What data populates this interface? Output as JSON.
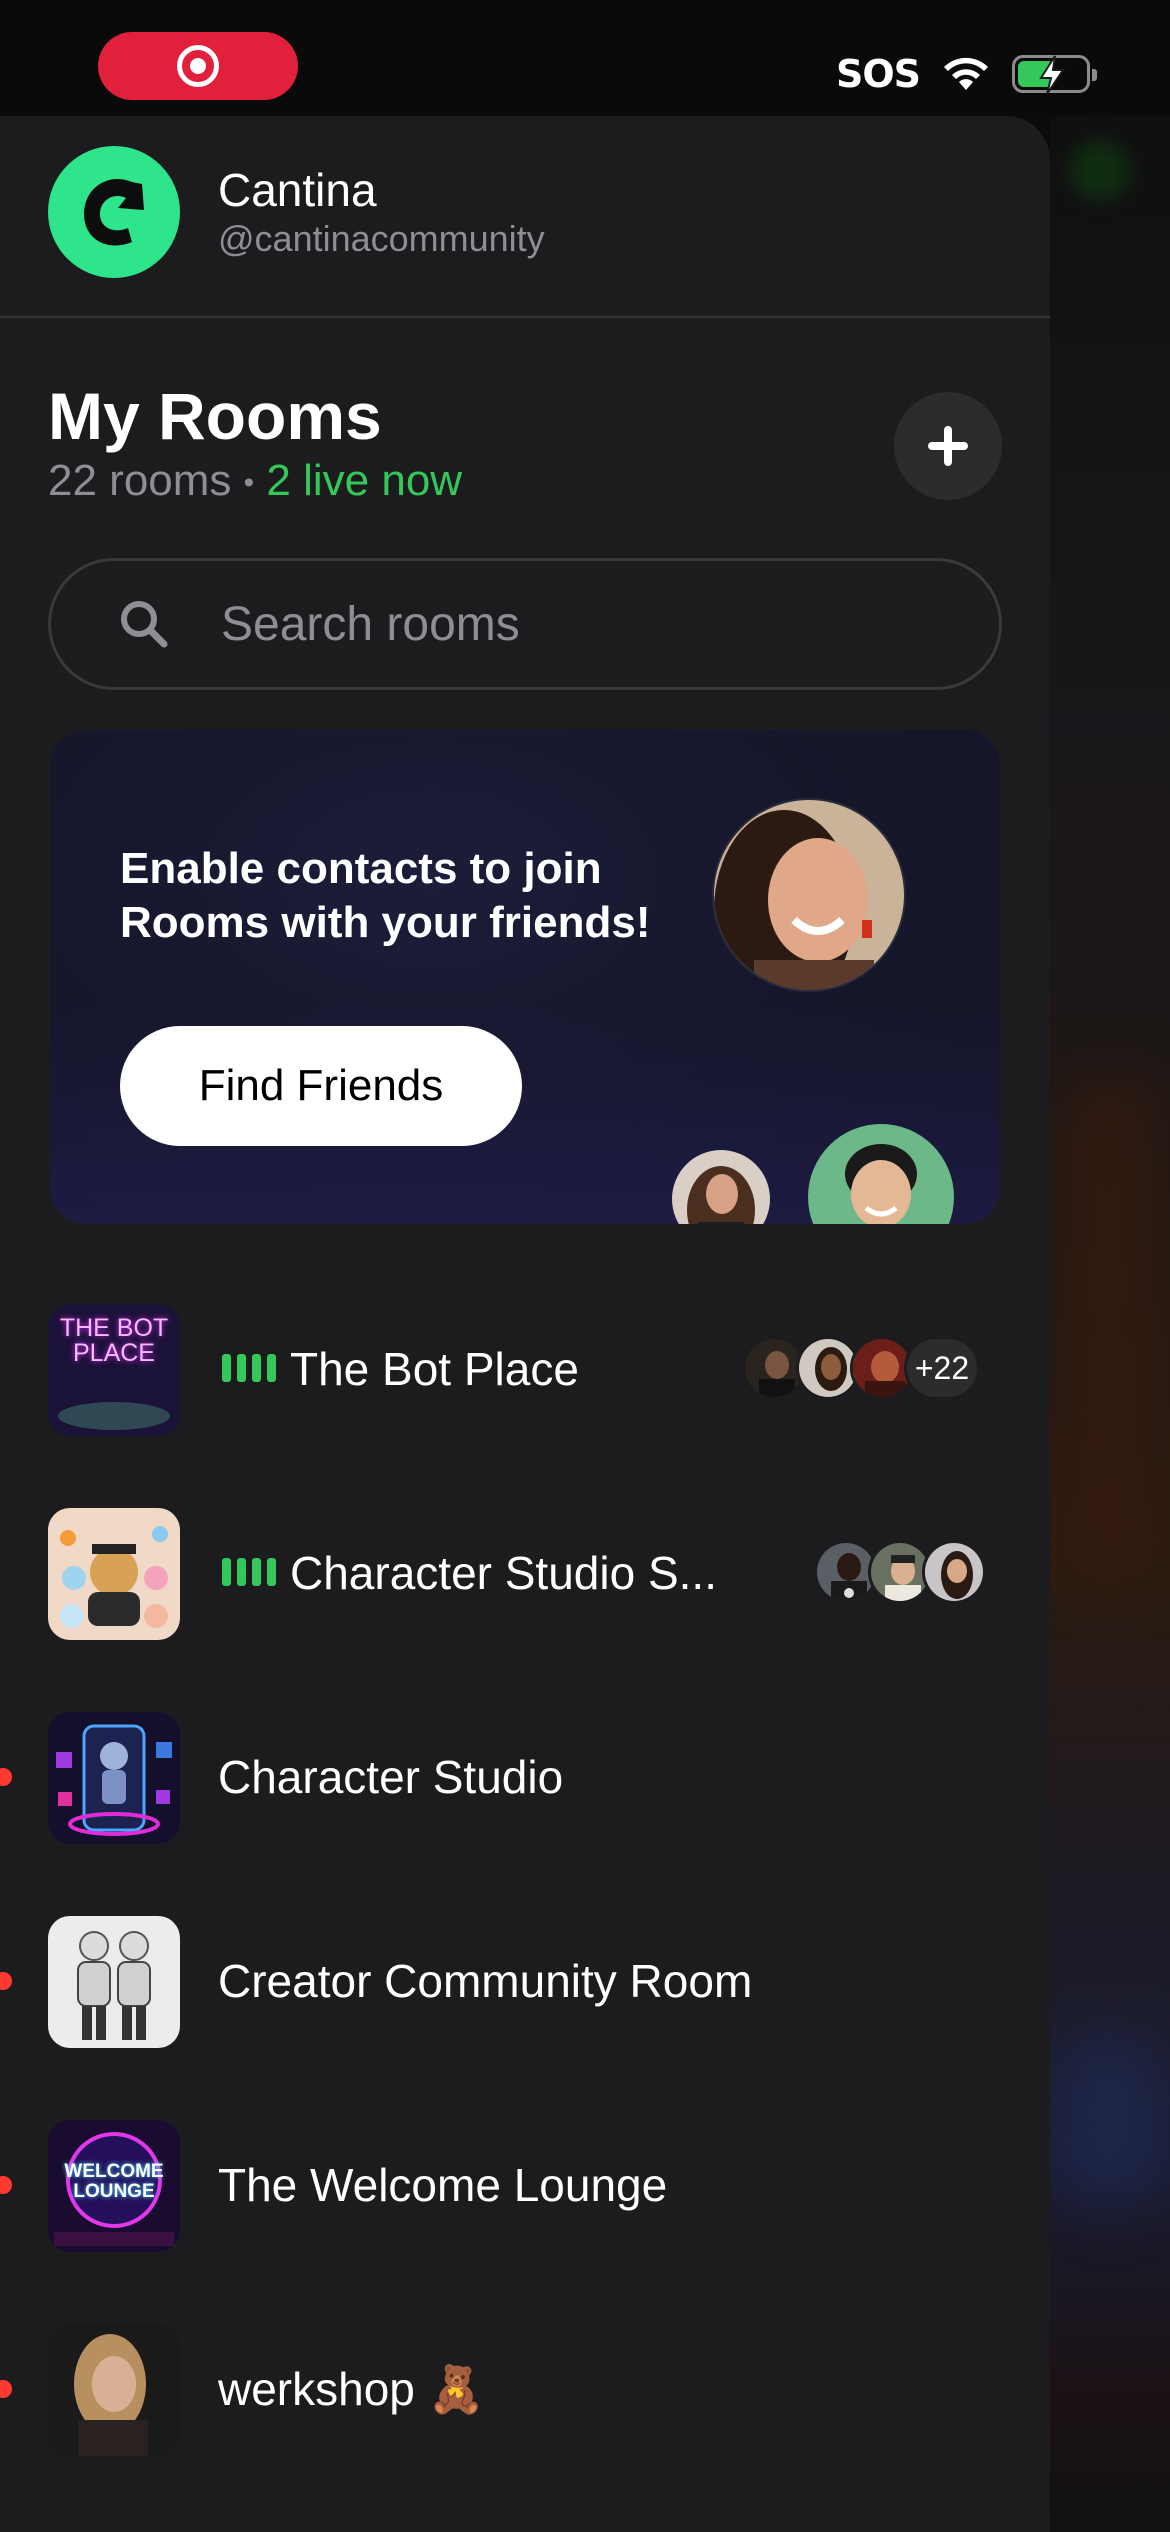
{
  "status_bar": {
    "sos": "SOS"
  },
  "profile": {
    "name": "Cantina",
    "handle": "@cantinacommunity"
  },
  "rooms_header": {
    "title": "My Rooms",
    "count": "22 rooms",
    "separator": "•",
    "live": "2 live now"
  },
  "search": {
    "placeholder": "Search rooms"
  },
  "promo": {
    "text": "Enable contacts to join Rooms with your friends!",
    "button": "Find Friends"
  },
  "rooms": [
    {
      "name": "The Bot Place",
      "thumb_text": "THE BOT PLACE",
      "live": true,
      "extra_count": "+22"
    },
    {
      "name": "Character Studio S...",
      "live": true
    },
    {
      "name": "Character Studio",
      "unread": true
    },
    {
      "name": "Creator Community Room",
      "unread": true
    },
    {
      "name": "The Welcome Lounge",
      "thumb_text": "WELCOME LOUNGE",
      "unread": true
    },
    {
      "name": "werkshop 🧸",
      "unread": true
    }
  ],
  "colors": {
    "accent_green": "#34c759",
    "logo_green": "#2ee58c",
    "record_red": "#e1213c",
    "drawer_bg": "#1c1c1e"
  }
}
